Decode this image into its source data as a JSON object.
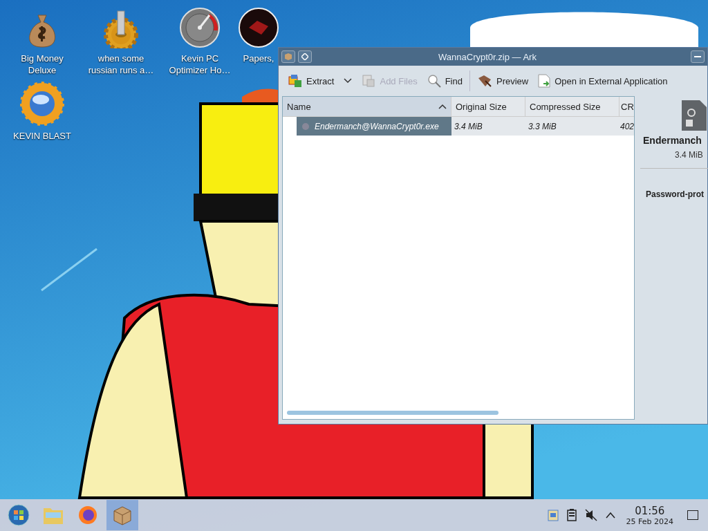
{
  "desktop_icons": [
    {
      "label": "Big Money Deluxe",
      "kind": "money"
    },
    {
      "label": "when some russian runs a…",
      "kind": "gear"
    },
    {
      "label": "Kevin PC Optimizer Ho…",
      "kind": "gauge"
    },
    {
      "label": "Papers,",
      "kind": "seal"
    },
    {
      "label": "KEVIN BLAST",
      "kind": "sun"
    }
  ],
  "window": {
    "title": "WannaCrypt0r.zip — Ark",
    "toolbar": [
      {
        "label": "Extract",
        "kind": "extract",
        "disabled": false,
        "has_menu": true
      },
      {
        "label": "Add Files",
        "kind": "add",
        "disabled": true,
        "has_menu": false
      },
      {
        "label": "Find",
        "kind": "find",
        "disabled": false,
        "has_menu": false
      },
      {
        "label": "Preview",
        "kind": "preview",
        "disabled": false,
        "has_menu": false
      },
      {
        "label": "Open in External Application",
        "kind": "open",
        "disabled": false,
        "has_menu": false
      }
    ],
    "table": {
      "columns": [
        {
          "label": "Name",
          "sorted": true
        },
        {
          "label": "Original Size",
          "sorted": false
        },
        {
          "label": "Compressed Size",
          "sorted": false
        },
        {
          "label": "CR",
          "sorted": false
        }
      ],
      "rows": [
        {
          "selected": true,
          "cells": [
            "Endermanch@WannaCrypt0r.exe",
            "3.4 MiB",
            "3.3 MiB",
            "402"
          ]
        }
      ]
    },
    "details": {
      "name": "Endermanch",
      "size": "3.4 MiB",
      "property": "Password-prot"
    }
  },
  "taskbar": {
    "items": [
      {
        "kind": "start",
        "active": false
      },
      {
        "kind": "folder",
        "active": false
      },
      {
        "kind": "browser",
        "active": false
      },
      {
        "kind": "archive",
        "active": true
      }
    ],
    "tray": [
      {
        "kind": "clipboard"
      },
      {
        "kind": "battery"
      },
      {
        "kind": "muted"
      },
      {
        "kind": "expand"
      }
    ],
    "time": "01:56",
    "date": "25 Feb 2024"
  }
}
